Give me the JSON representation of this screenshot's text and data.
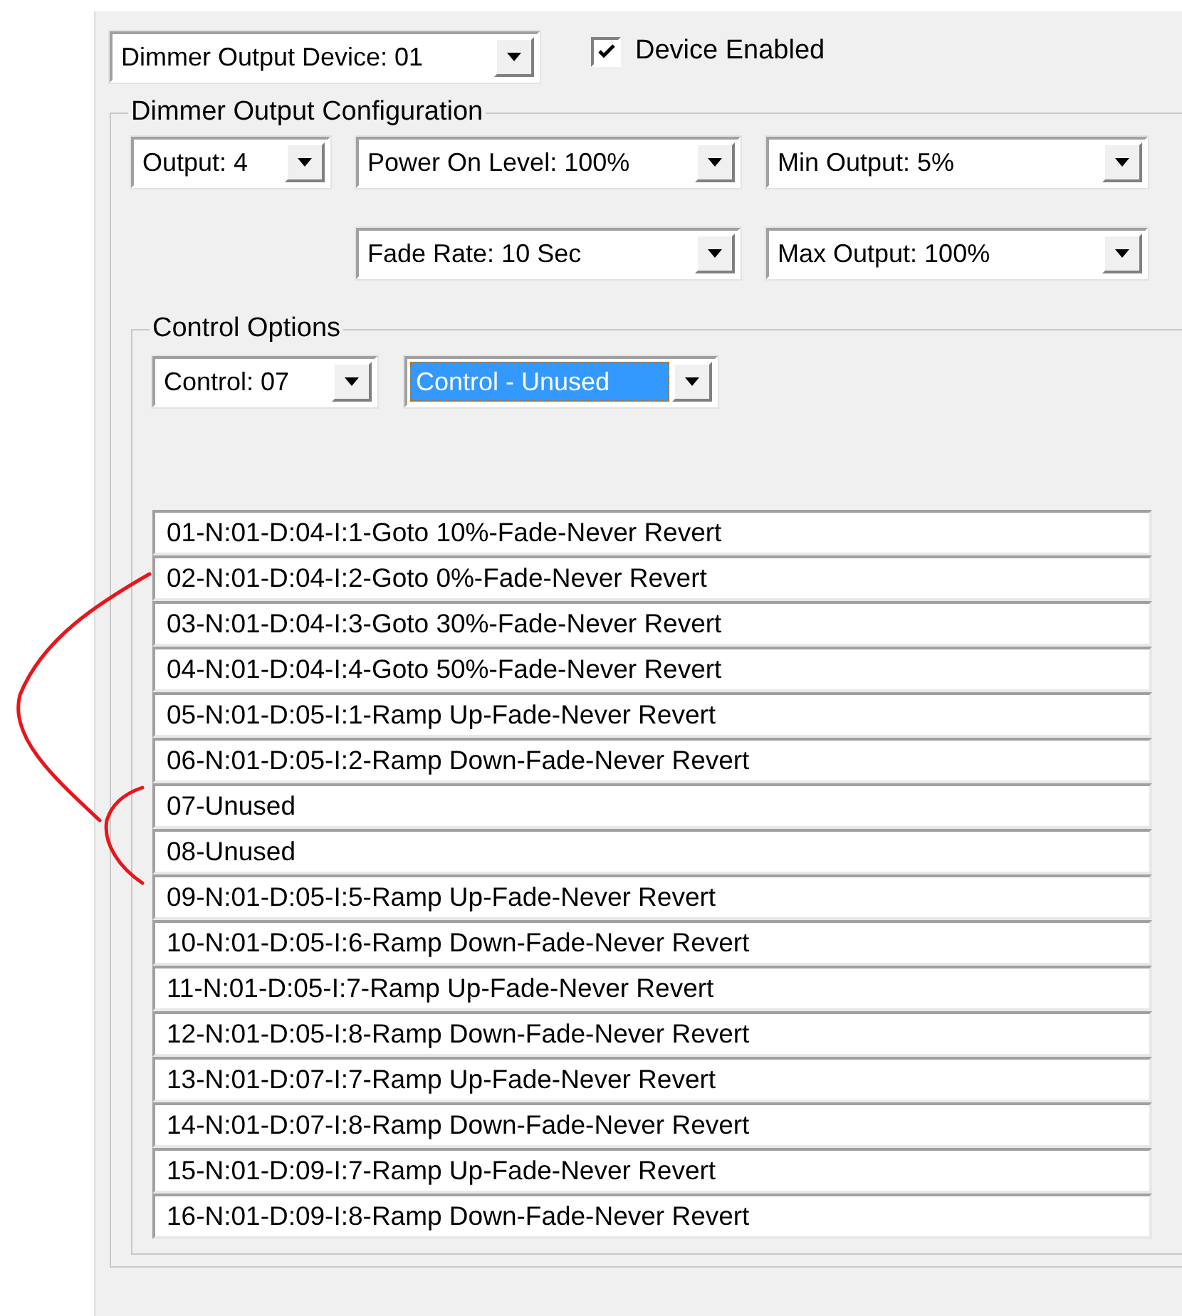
{
  "device_select": {
    "value": "Dimmer Output Device: 01"
  },
  "device_enabled": {
    "label": "Device Enabled",
    "checked": true
  },
  "dimmer_config": {
    "title": "Dimmer Output Configuration",
    "rows": [
      {
        "selects": [
          {
            "value": "Output: 4"
          },
          {
            "value": "Power On Level: 100%"
          },
          {
            "value": "Min Output: 5%"
          }
        ]
      },
      {
        "selects": [
          {
            "value": "Fade Rate: 10 Sec"
          },
          {
            "value": "Max Output: 100%"
          }
        ]
      }
    ]
  },
  "control_options": {
    "title": "Control Options",
    "selects": [
      {
        "value": "Control: 07",
        "focused": false
      },
      {
        "value": "Control - Unused",
        "focused": true
      }
    ],
    "list": [
      {
        "text": "01-N:01-D:04-I:1-Goto 10%-Fade-Never Revert"
      },
      {
        "text": "02-N:01-D:04-I:2-Goto 0%-Fade-Never Revert"
      },
      {
        "text": "03-N:01-D:04-I:3-Goto 30%-Fade-Never Revert"
      },
      {
        "text": "04-N:01-D:04-I:4-Goto 50%-Fade-Never Revert"
      },
      {
        "text": "05-N:01-D:05-I:1-Ramp Up-Fade-Never Revert"
      },
      {
        "text": "06-N:01-D:05-I:2-Ramp Down-Fade-Never Revert"
      },
      {
        "text": "07-Unused"
      },
      {
        "text": "08-Unused"
      },
      {
        "text": "09-N:01-D:05-I:5-Ramp Up-Fade-Never Revert"
      },
      {
        "text": "10-N:01-D:05-I:6-Ramp Down-Fade-Never Revert"
      },
      {
        "text": "11-N:01-D:05-I:7-Ramp Up-Fade-Never Revert"
      },
      {
        "text": "12-N:01-D:05-I:8-Ramp Down-Fade-Never Revert"
      },
      {
        "text": "13-N:01-D:07-I:7-Ramp Up-Fade-Never Revert"
      },
      {
        "text": "14-N:01-D:07-I:8-Ramp Down-Fade-Never Revert"
      },
      {
        "text": "15-N:01-D:09-I:7-Ramp Up-Fade-Never Revert"
      },
      {
        "text": "16-N:01-D:09-I:8-Ramp Down-Fade-Never Revert"
      }
    ]
  }
}
